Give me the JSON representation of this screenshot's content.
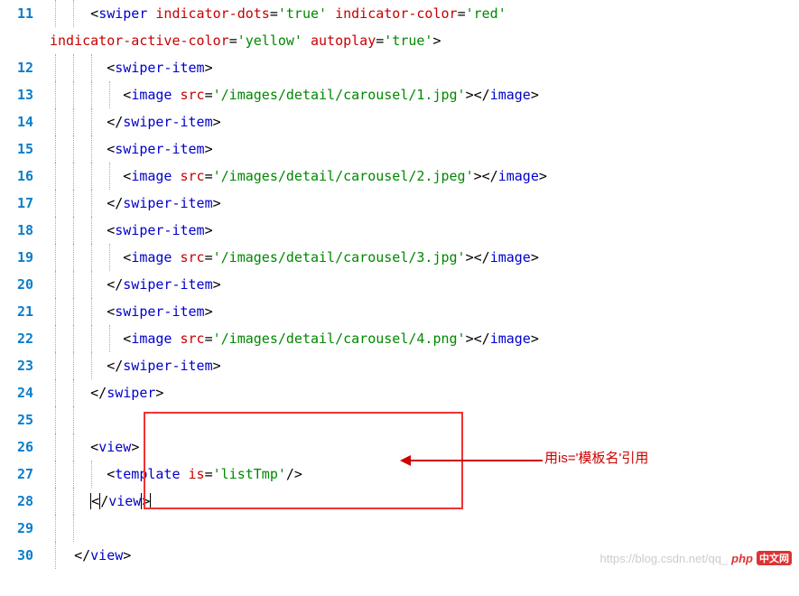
{
  "lineNumbers": [
    "11",
    "12",
    "13",
    "14",
    "15",
    "16",
    "17",
    "18",
    "19",
    "20",
    "21",
    "22",
    "23",
    "24",
    "25",
    "26",
    "27",
    "28",
    "29",
    "30"
  ],
  "lines": {
    "l11a": "swiper",
    "l11b": "indicator-dots",
    "l11c": "'true'",
    "l11d": "indicator-color",
    "l11e": "'red'",
    "l11f": "indicator-active-color",
    "l11g": "'yellow'",
    "l11h": "autoplay",
    "l11i": "'true'",
    "swItemOpen": "swiper-item",
    "imgTag": "image",
    "srcAttr": "src",
    "src1": "'/images/detail/carousel/1.jpg'",
    "src2": "'/images/detail/carousel/2.jpeg'",
    "src3": "'/images/detail/carousel/3.jpg'",
    "src4": "'/images/detail/carousel/4.png'",
    "swiperClose": "swiper",
    "viewTag": "view",
    "templateTag": "template",
    "isAttr": "is",
    "isVal": "'listTmp'"
  },
  "annotation": "用is='模板名'引用",
  "watermark": {
    "url": "https://blog.csdn.net/qq_",
    "brand": "php",
    "cn": "中文网"
  }
}
